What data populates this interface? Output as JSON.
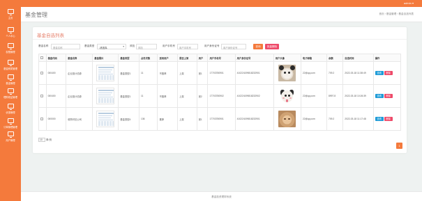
{
  "topbar": {
    "user": "admin ▾"
  },
  "sidebar": {
    "items": [
      {
        "label": "主页"
      },
      {
        "label": "个人中心"
      },
      {
        "label": "权限管理"
      },
      {
        "label": "基金种类管理"
      },
      {
        "label": "基金管理"
      },
      {
        "label": "理财收益管理"
      },
      {
        "label": "优惠管理"
      },
      {
        "label": "订单管理管理"
      },
      {
        "label": "用户管理"
      }
    ]
  },
  "header": {
    "title": "基金管理",
    "breadcrumb": "首页  ›  基金管理  ›  基金自选列表"
  },
  "card": {
    "title": "基金自选列表"
  },
  "filters": {
    "fund_name_label": "基金名称",
    "fund_name_placeholder": "基金名称",
    "fund_type_label": "基金类型",
    "fund_type_value": "-请选择-",
    "risk_label": "风险",
    "risk_placeholder": "风险",
    "phone_label": "用户手机号",
    "phone_placeholder": "用户手机号",
    "idcard_label": "用户身份证号",
    "idcard_placeholder": "用户身份证号",
    "search_label": "查询",
    "batch_delete_label": "批量删除"
  },
  "table": {
    "headers": [
      "",
      "基金代码",
      "基金名称",
      "基金照片",
      "基金类型",
      "点击次数",
      "适用用户",
      "是否上架",
      "用户",
      "用户手机号",
      "用户身份证号",
      "用户头像",
      "电子邮箱",
      "余额",
      "自选时间",
      "操作"
    ],
    "rows": [
      {
        "code": "000400",
        "name": "企业投计债券",
        "type": "基金类型1",
        "clicks": "11",
        "users": "不推荐",
        "listed": "上架",
        "user": "张1",
        "phone": "17703780901",
        "idcard": "410224199818232901",
        "email": "22@qq.com",
        "balance": "709.2",
        "time": "2022-03-18 11:38:49",
        "avatar": "bear"
      },
      {
        "code": "000400",
        "name": "企业投计债券",
        "type": "基金类型1",
        "clicks": "11",
        "users": "不推荐",
        "listed": "上架",
        "user": "张2",
        "phone": "17703780902",
        "idcard": "410224199818232902",
        "email": "22@qq.com",
        "balance": "8997.8",
        "time": "2022-03-18 10:26:39",
        "avatar": "dog"
      },
      {
        "code": "000000",
        "name": "收购可债公司",
        "type": "基金类型4",
        "clicks": "136",
        "users": "推荐",
        "listed": "上架",
        "user": "张1",
        "phone": "17703780901",
        "idcard": "410224199818232901",
        "email": "22@qq.com",
        "balance": "709.2",
        "time": "2022-03-18 11:17:48",
        "avatar": "cat"
      }
    ],
    "view_label": "查看",
    "delete_label": "删除"
  },
  "pagination": {
    "page_size": "10",
    "suffix": "条/页",
    "current_page": "1"
  },
  "footer": {
    "text": "基金投资理财系统"
  },
  "colors": {
    "primary": "#f47a3c",
    "danger": "#ee4a69",
    "info": "#1e9bd7",
    "title": "#e57f6a"
  }
}
